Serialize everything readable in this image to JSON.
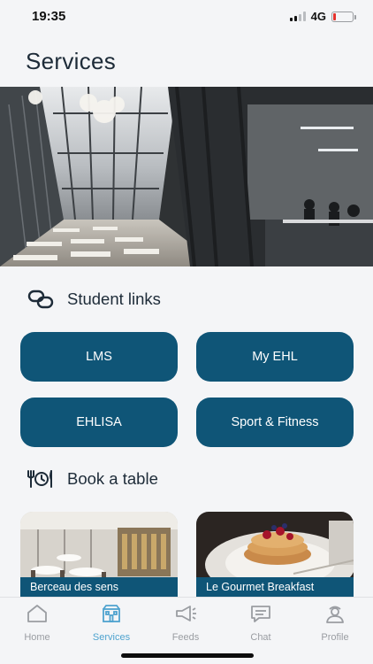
{
  "status_bar": {
    "time": "19:35",
    "network": "4G",
    "battery_level": 0.15,
    "battery_color": "#e5322d"
  },
  "page": {
    "title": "Services"
  },
  "hero": {
    "icon": "atrium-photo"
  },
  "student_links": {
    "title": "Student links",
    "icon": "link-icon",
    "buttons": [
      {
        "label": "LMS"
      },
      {
        "label": "My EHL"
      },
      {
        "label": "EHLISA"
      },
      {
        "label": "Sport & Fitness"
      }
    ]
  },
  "book_table": {
    "title": "Book a table",
    "icon": "cutlery-clock-icon",
    "restaurants": [
      {
        "name": "Berceau des sens"
      },
      {
        "name": "Le Gourmet Breakfast"
      }
    ]
  },
  "tab_bar": {
    "active": "Services",
    "tabs": [
      {
        "label": "Home",
        "icon": "home-icon"
      },
      {
        "label": "Services",
        "icon": "building-icon"
      },
      {
        "label": "Feeds",
        "icon": "megaphone-icon"
      },
      {
        "label": "Chat",
        "icon": "chat-icon"
      },
      {
        "label": "Profile",
        "icon": "profile-icon"
      }
    ]
  },
  "colors": {
    "primary": "#0f5577",
    "active_tab": "#4fa3cf",
    "inactive_tab": "#9a9da2",
    "background": "#f4f5f7"
  }
}
